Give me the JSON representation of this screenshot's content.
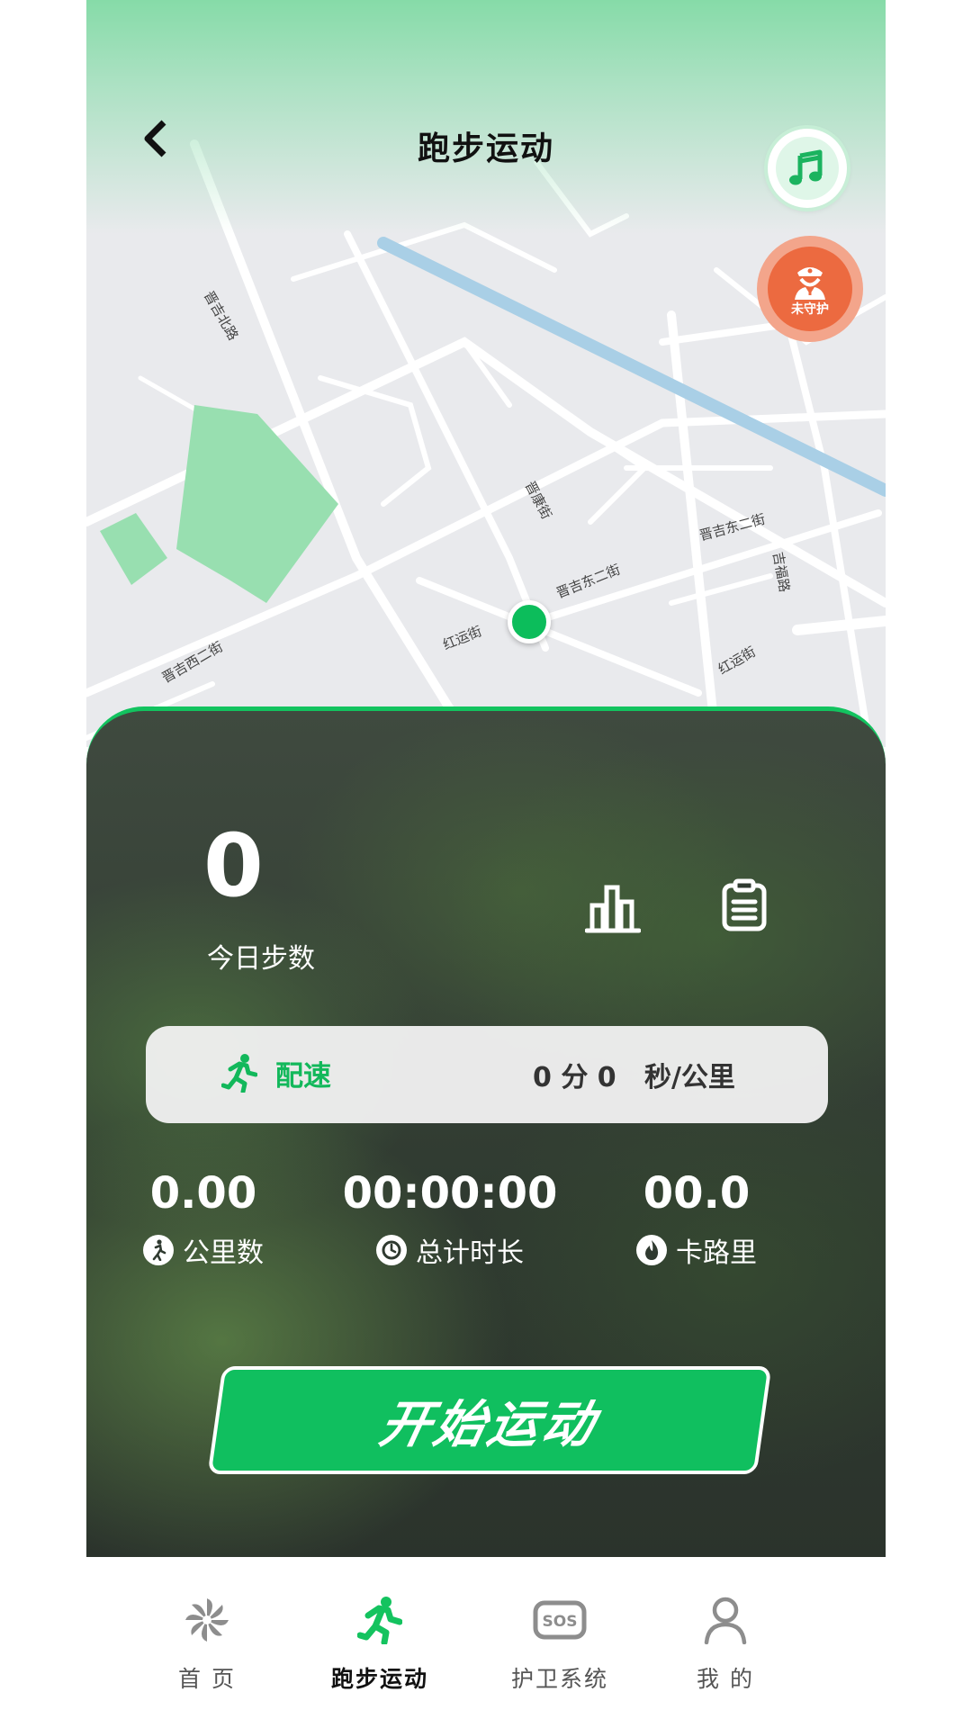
{
  "header": {
    "title": "跑步运动"
  },
  "map": {
    "guard_badge_text": "未守护",
    "streets": [
      "晋吉北路",
      "晋康街",
      "晋吉东二街",
      "晋吉东二街",
      "吉福路",
      "红运街",
      "红运街",
      "晋吉西二街"
    ]
  },
  "stats": {
    "steps_value": "0",
    "steps_label": "今日步数"
  },
  "pace": {
    "label": "配速",
    "value": "0 分 0   秒/公里"
  },
  "metrics": [
    {
      "value": "0.00",
      "label": "公里数",
      "icon": "walk-icon"
    },
    {
      "value": "00:00:00",
      "label": "总计时长",
      "icon": "clock-icon"
    },
    {
      "value": "00.0",
      "label": "卡路里",
      "icon": "flame-icon"
    }
  ],
  "start_button": {
    "label": "开始运动"
  },
  "bottom_nav": [
    {
      "label": "首 页",
      "icon": "pinwheel-icon",
      "active": false
    },
    {
      "label": "跑步运动",
      "icon": "runner-icon",
      "active": true
    },
    {
      "label": "护卫系统",
      "icon": "sos-icon",
      "active": false
    },
    {
      "label": "我 的",
      "icon": "person-icon",
      "active": false
    }
  ],
  "colors": {
    "accent": "#12c35f",
    "guard": "#ec6a40",
    "panel_bg": "#2f3a30"
  }
}
